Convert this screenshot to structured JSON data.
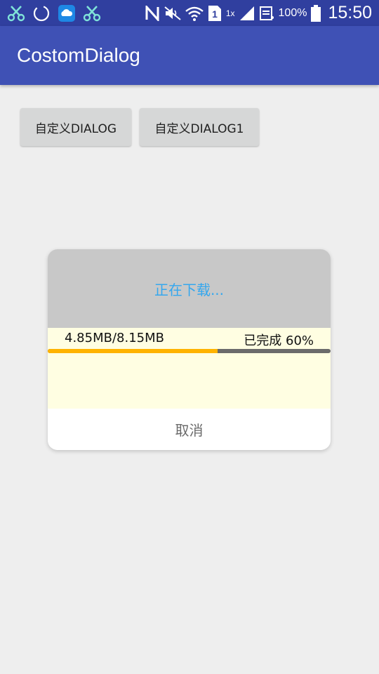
{
  "status_bar": {
    "notification_icons": [
      "scissors-icon",
      "sync-circle-icon",
      "cloud-app-icon",
      "scissors-icon"
    ],
    "network_speed": "1x",
    "sim_label": "1",
    "battery_text": "100%",
    "clock": "15:50"
  },
  "app_bar": {
    "title": "CostomDialog",
    "color": "#3f51b5"
  },
  "buttons": {
    "custom_dialog": "自定义DIALOG",
    "custom_dialog1": "自定义DIALOG1"
  },
  "dialog": {
    "title": "正在下载...",
    "size_text": "4.85MB/8.15MB",
    "percent_text": "已完成 60%",
    "progress": 0.6,
    "cancel_label": "取消",
    "title_color": "#35a7ee",
    "progress_color": "#ffb300"
  }
}
